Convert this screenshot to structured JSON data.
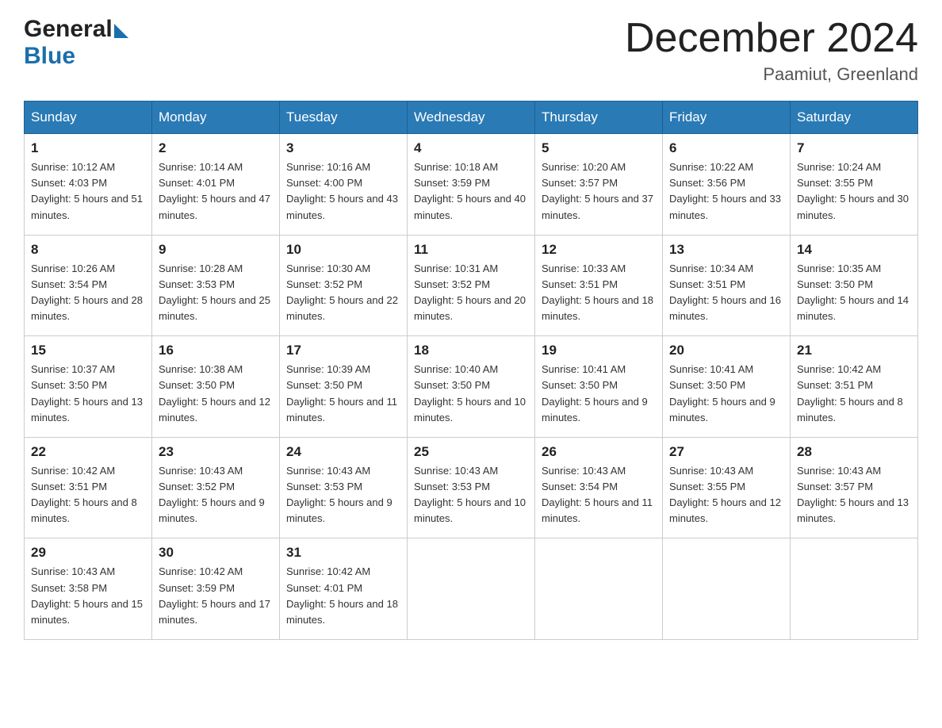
{
  "header": {
    "logo_general": "General",
    "logo_blue": "Blue",
    "month_title": "December 2024",
    "location": "Paamiut, Greenland"
  },
  "days_of_week": [
    "Sunday",
    "Monday",
    "Tuesday",
    "Wednesday",
    "Thursday",
    "Friday",
    "Saturday"
  ],
  "weeks": [
    [
      {
        "day": "1",
        "sunrise": "10:12 AM",
        "sunset": "4:03 PM",
        "daylight": "5 hours and 51 minutes."
      },
      {
        "day": "2",
        "sunrise": "10:14 AM",
        "sunset": "4:01 PM",
        "daylight": "5 hours and 47 minutes."
      },
      {
        "day": "3",
        "sunrise": "10:16 AM",
        "sunset": "4:00 PM",
        "daylight": "5 hours and 43 minutes."
      },
      {
        "day": "4",
        "sunrise": "10:18 AM",
        "sunset": "3:59 PM",
        "daylight": "5 hours and 40 minutes."
      },
      {
        "day": "5",
        "sunrise": "10:20 AM",
        "sunset": "3:57 PM",
        "daylight": "5 hours and 37 minutes."
      },
      {
        "day": "6",
        "sunrise": "10:22 AM",
        "sunset": "3:56 PM",
        "daylight": "5 hours and 33 minutes."
      },
      {
        "day": "7",
        "sunrise": "10:24 AM",
        "sunset": "3:55 PM",
        "daylight": "5 hours and 30 minutes."
      }
    ],
    [
      {
        "day": "8",
        "sunrise": "10:26 AM",
        "sunset": "3:54 PM",
        "daylight": "5 hours and 28 minutes."
      },
      {
        "day": "9",
        "sunrise": "10:28 AM",
        "sunset": "3:53 PM",
        "daylight": "5 hours and 25 minutes."
      },
      {
        "day": "10",
        "sunrise": "10:30 AM",
        "sunset": "3:52 PM",
        "daylight": "5 hours and 22 minutes."
      },
      {
        "day": "11",
        "sunrise": "10:31 AM",
        "sunset": "3:52 PM",
        "daylight": "5 hours and 20 minutes."
      },
      {
        "day": "12",
        "sunrise": "10:33 AM",
        "sunset": "3:51 PM",
        "daylight": "5 hours and 18 minutes."
      },
      {
        "day": "13",
        "sunrise": "10:34 AM",
        "sunset": "3:51 PM",
        "daylight": "5 hours and 16 minutes."
      },
      {
        "day": "14",
        "sunrise": "10:35 AM",
        "sunset": "3:50 PM",
        "daylight": "5 hours and 14 minutes."
      }
    ],
    [
      {
        "day": "15",
        "sunrise": "10:37 AM",
        "sunset": "3:50 PM",
        "daylight": "5 hours and 13 minutes."
      },
      {
        "day": "16",
        "sunrise": "10:38 AM",
        "sunset": "3:50 PM",
        "daylight": "5 hours and 12 minutes."
      },
      {
        "day": "17",
        "sunrise": "10:39 AM",
        "sunset": "3:50 PM",
        "daylight": "5 hours and 11 minutes."
      },
      {
        "day": "18",
        "sunrise": "10:40 AM",
        "sunset": "3:50 PM",
        "daylight": "5 hours and 10 minutes."
      },
      {
        "day": "19",
        "sunrise": "10:41 AM",
        "sunset": "3:50 PM",
        "daylight": "5 hours and 9 minutes."
      },
      {
        "day": "20",
        "sunrise": "10:41 AM",
        "sunset": "3:50 PM",
        "daylight": "5 hours and 9 minutes."
      },
      {
        "day": "21",
        "sunrise": "10:42 AM",
        "sunset": "3:51 PM",
        "daylight": "5 hours and 8 minutes."
      }
    ],
    [
      {
        "day": "22",
        "sunrise": "10:42 AM",
        "sunset": "3:51 PM",
        "daylight": "5 hours and 8 minutes."
      },
      {
        "day": "23",
        "sunrise": "10:43 AM",
        "sunset": "3:52 PM",
        "daylight": "5 hours and 9 minutes."
      },
      {
        "day": "24",
        "sunrise": "10:43 AM",
        "sunset": "3:53 PM",
        "daylight": "5 hours and 9 minutes."
      },
      {
        "day": "25",
        "sunrise": "10:43 AM",
        "sunset": "3:53 PM",
        "daylight": "5 hours and 10 minutes."
      },
      {
        "day": "26",
        "sunrise": "10:43 AM",
        "sunset": "3:54 PM",
        "daylight": "5 hours and 11 minutes."
      },
      {
        "day": "27",
        "sunrise": "10:43 AM",
        "sunset": "3:55 PM",
        "daylight": "5 hours and 12 minutes."
      },
      {
        "day": "28",
        "sunrise": "10:43 AM",
        "sunset": "3:57 PM",
        "daylight": "5 hours and 13 minutes."
      }
    ],
    [
      {
        "day": "29",
        "sunrise": "10:43 AM",
        "sunset": "3:58 PM",
        "daylight": "5 hours and 15 minutes."
      },
      {
        "day": "30",
        "sunrise": "10:42 AM",
        "sunset": "3:59 PM",
        "daylight": "5 hours and 17 minutes."
      },
      {
        "day": "31",
        "sunrise": "10:42 AM",
        "sunset": "4:01 PM",
        "daylight": "5 hours and 18 minutes."
      },
      null,
      null,
      null,
      null
    ]
  ],
  "labels": {
    "sunrise_prefix": "Sunrise: ",
    "sunset_prefix": "Sunset: ",
    "daylight_prefix": "Daylight: "
  }
}
